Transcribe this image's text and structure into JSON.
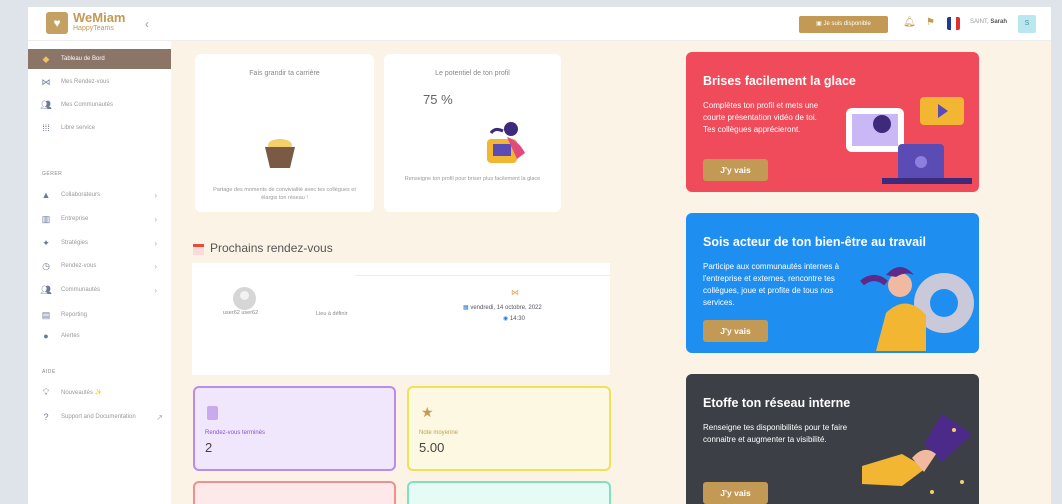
{
  "brand": {
    "name": "WeMiam",
    "tagline": "HappyTeams"
  },
  "topbar": {
    "dispo_label": "Je suis disponible",
    "user_name_prefix": "SAINT, ",
    "user_name": "Sarah",
    "avatar_initial": "S"
  },
  "sidebar": {
    "items": [
      {
        "label": "Tableau de Bord",
        "icon": "home-icon"
      },
      {
        "label": "Mes Rendez-vous",
        "icon": "handshake-icon"
      },
      {
        "label": "Mes Communautés",
        "icon": "users-icon"
      },
      {
        "label": "Libre service",
        "icon": "grid-icon"
      }
    ],
    "section_gerer": "GÉRER",
    "manage_items": [
      {
        "label": "Collaborateurs",
        "icon": "user-icon"
      },
      {
        "label": "Entreprise",
        "icon": "building-icon"
      },
      {
        "label": "Stratégies",
        "icon": "strategy-icon"
      },
      {
        "label": "Rendez-vous",
        "icon": "clock-icon"
      },
      {
        "label": "Communautés",
        "icon": "users-icon"
      },
      {
        "label": "Reporting",
        "icon": "chart-icon"
      },
      {
        "label": "Alertes",
        "icon": "alert-icon"
      }
    ],
    "section_aide": "AIDE",
    "help_items": [
      {
        "label": "Nouveautés ✨",
        "icon": "bulb-icon"
      },
      {
        "label": "Support and Documentation",
        "icon": "help-icon"
      }
    ]
  },
  "career_card": {
    "title": "Fais grandir ta carrière",
    "footer": "Partage des moments de convivialité avec tes collègues et élargis ton réseau !"
  },
  "profile_card": {
    "title": "Le potentiel de ton profil",
    "value": "75 %",
    "footer": "Renseigne ton profil pour briser plus facilement la glace"
  },
  "rdv": {
    "heading": "Prochains rendez-vous",
    "user": "user62 user62",
    "place": "Lieu à définir",
    "date": "vendredi, 14 octobre, 2022",
    "time": "14:30"
  },
  "stats": [
    {
      "label": "Rendez-vous terminés",
      "value": "2"
    },
    {
      "label": "Note moyenne",
      "value": "5.00"
    }
  ],
  "promos": [
    {
      "title": "Brises facilement la glace",
      "text": "Complètes ton profil et mets une courte présentation vidéo de toi. Tes collègues apprécieront.",
      "button": "J'y vais",
      "color": "#f04b5a"
    },
    {
      "title": "Sois acteur de ton bien-être au travail",
      "text": "Participe aux communautés internes à l'entreprise et externes, rencontre tes collègues, joue et profite de tous nos services.",
      "button": "J'y vais",
      "color": "#1f8ef1"
    },
    {
      "title": "Etoffe ton réseau interne",
      "text": "Renseigne tes disponibilités pour te faire connaitre et augmenter ta visibilité.",
      "button": "J'y vais",
      "color": "#3c3f46"
    }
  ]
}
